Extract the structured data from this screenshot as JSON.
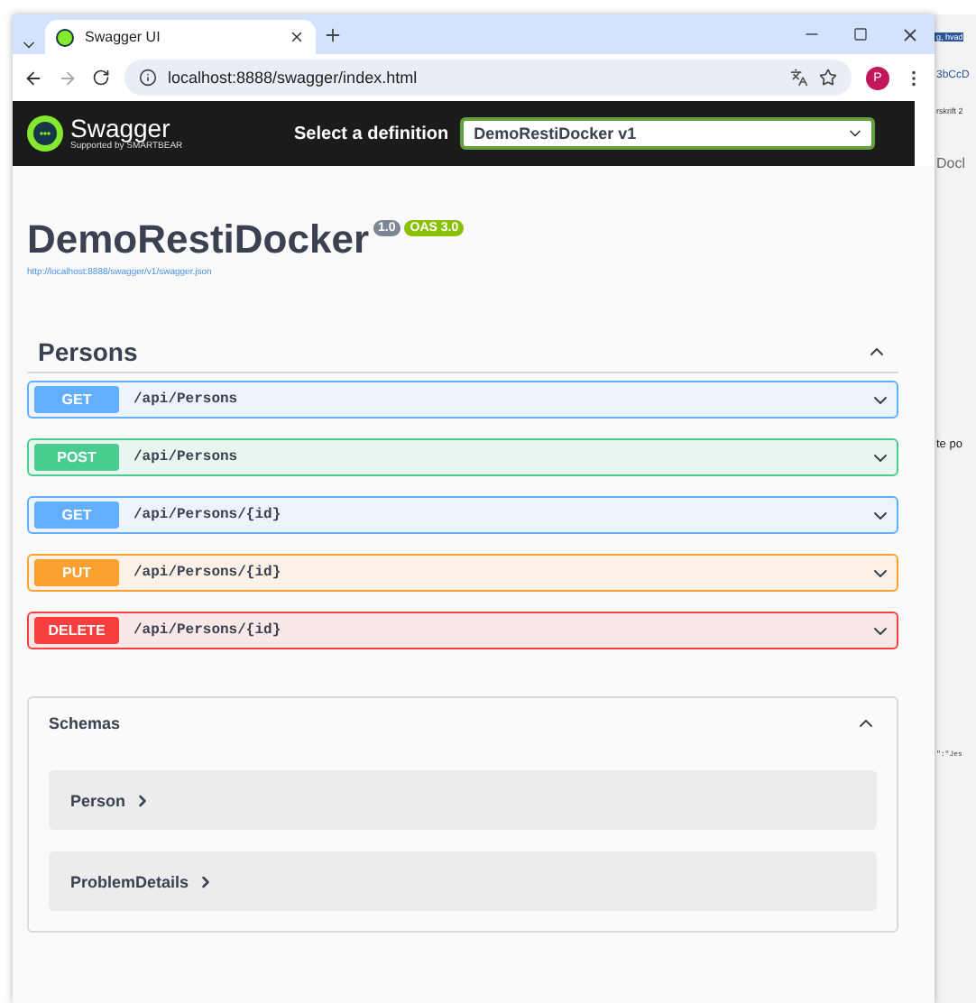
{
  "browser": {
    "tab_title": "Swagger UI",
    "address": "localhost:8888/swagger/index.html",
    "profile_initial": "P"
  },
  "header": {
    "logo_text": "Swagger",
    "logo_subtext": "Supported by SMARTBEAR",
    "definition_label": "Select a definition",
    "definition_value": "DemoRestiDocker v1"
  },
  "info": {
    "title": "DemoRestiDocker",
    "version": "1.0",
    "oas": "OAS 3.0",
    "url": "http://localhost:8888/swagger/v1/swagger.json"
  },
  "tag": {
    "name": "Persons",
    "expanded": true,
    "operations": [
      {
        "method": "GET",
        "path": "/api/Persons",
        "expanded": false
      },
      {
        "method": "POST",
        "path": "/api/Persons",
        "expanded": false
      },
      {
        "method": "GET",
        "path": "/api/Persons/{id}",
        "expanded": false
      },
      {
        "method": "PUT",
        "path": "/api/Persons/{id}",
        "expanded": false
      },
      {
        "method": "DELETE",
        "path": "/api/Persons/{id}",
        "expanded": false
      }
    ]
  },
  "schemas": {
    "title": "Schemas",
    "expanded": true,
    "models": [
      "Person",
      "ProblemDetails"
    ]
  },
  "background_window": {
    "lines": [
      "g, hvad",
      "3bCcD",
      "rskrift 2",
      "Docl",
      "te po",
      "\":\"Jes"
    ]
  }
}
